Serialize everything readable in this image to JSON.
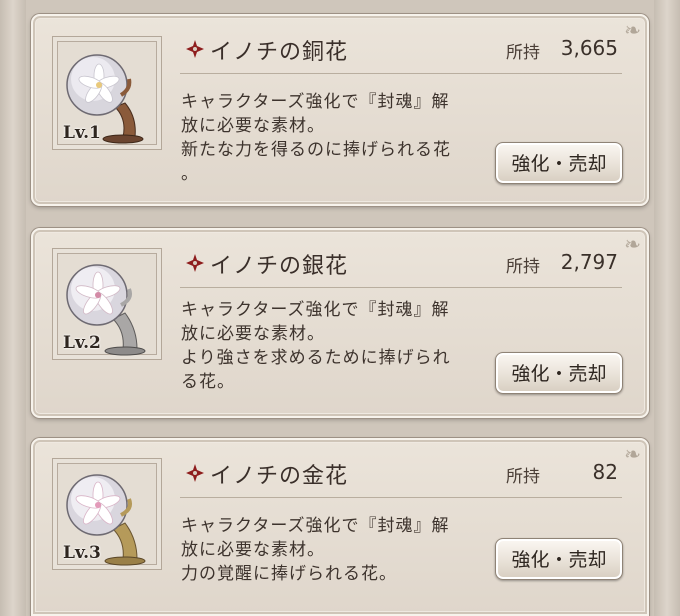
{
  "held_label": "所持",
  "action_label": "強化・売却",
  "items": [
    {
      "name": "イノチの銅花",
      "count": "3,665",
      "level": "Lv.1",
      "description": "キャラクターズ強化で『封魂』解\n放に必要な素材。\n新たな力を得るのに捧げられる花\n。",
      "icon": "copper-flower-orb-icon",
      "stand_color": "#8a5a3a"
    },
    {
      "name": "イノチの銀花",
      "count": "2,797",
      "level": "Lv.2",
      "description": "キャラクターズ強化で『封魂』解\n放に必要な素材。\nより強さを求めるために捧げられ\nる花。",
      "icon": "silver-flower-orb-icon",
      "stand_color": "#a9a7a6"
    },
    {
      "name": "イノチの金花",
      "count": "82",
      "level": "Lv.3",
      "description": "キャラクターズ強化で『封魂』解\n放に必要な素材。\n力の覚醒に捧げられる花。",
      "icon": "gold-flower-orb-icon",
      "stand_color": "#b59a5a"
    }
  ]
}
